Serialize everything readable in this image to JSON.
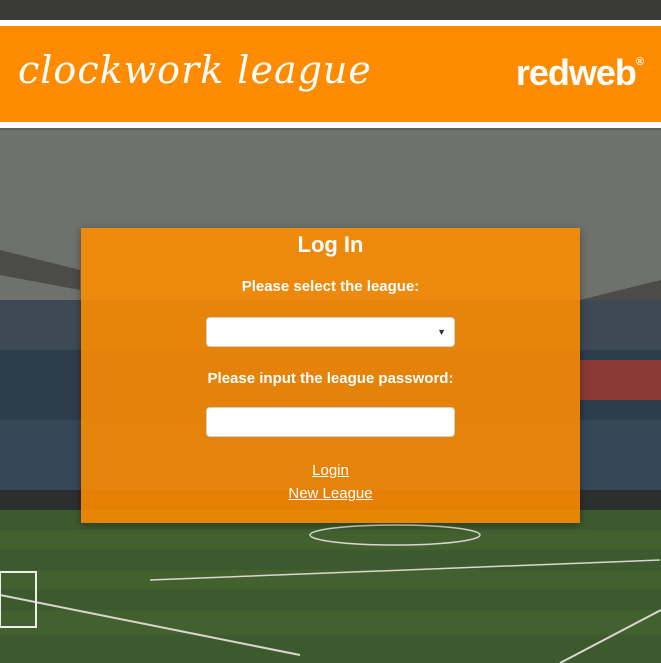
{
  "header": {
    "brand_title": "clockwork league",
    "partner_logo": "redweb",
    "partner_registered": "®"
  },
  "login_panel": {
    "title": "Log In",
    "league_select_label": "Please select the league:",
    "league_select_value": "",
    "password_label": "Please input the league password:",
    "password_value": "",
    "login_link": "Login",
    "new_league_link": "New League"
  },
  "icons": {
    "select_arrow": "chevron-down-icon"
  },
  "colors": {
    "accent": "#ff8c00",
    "text_on_accent": "#ffffff"
  }
}
